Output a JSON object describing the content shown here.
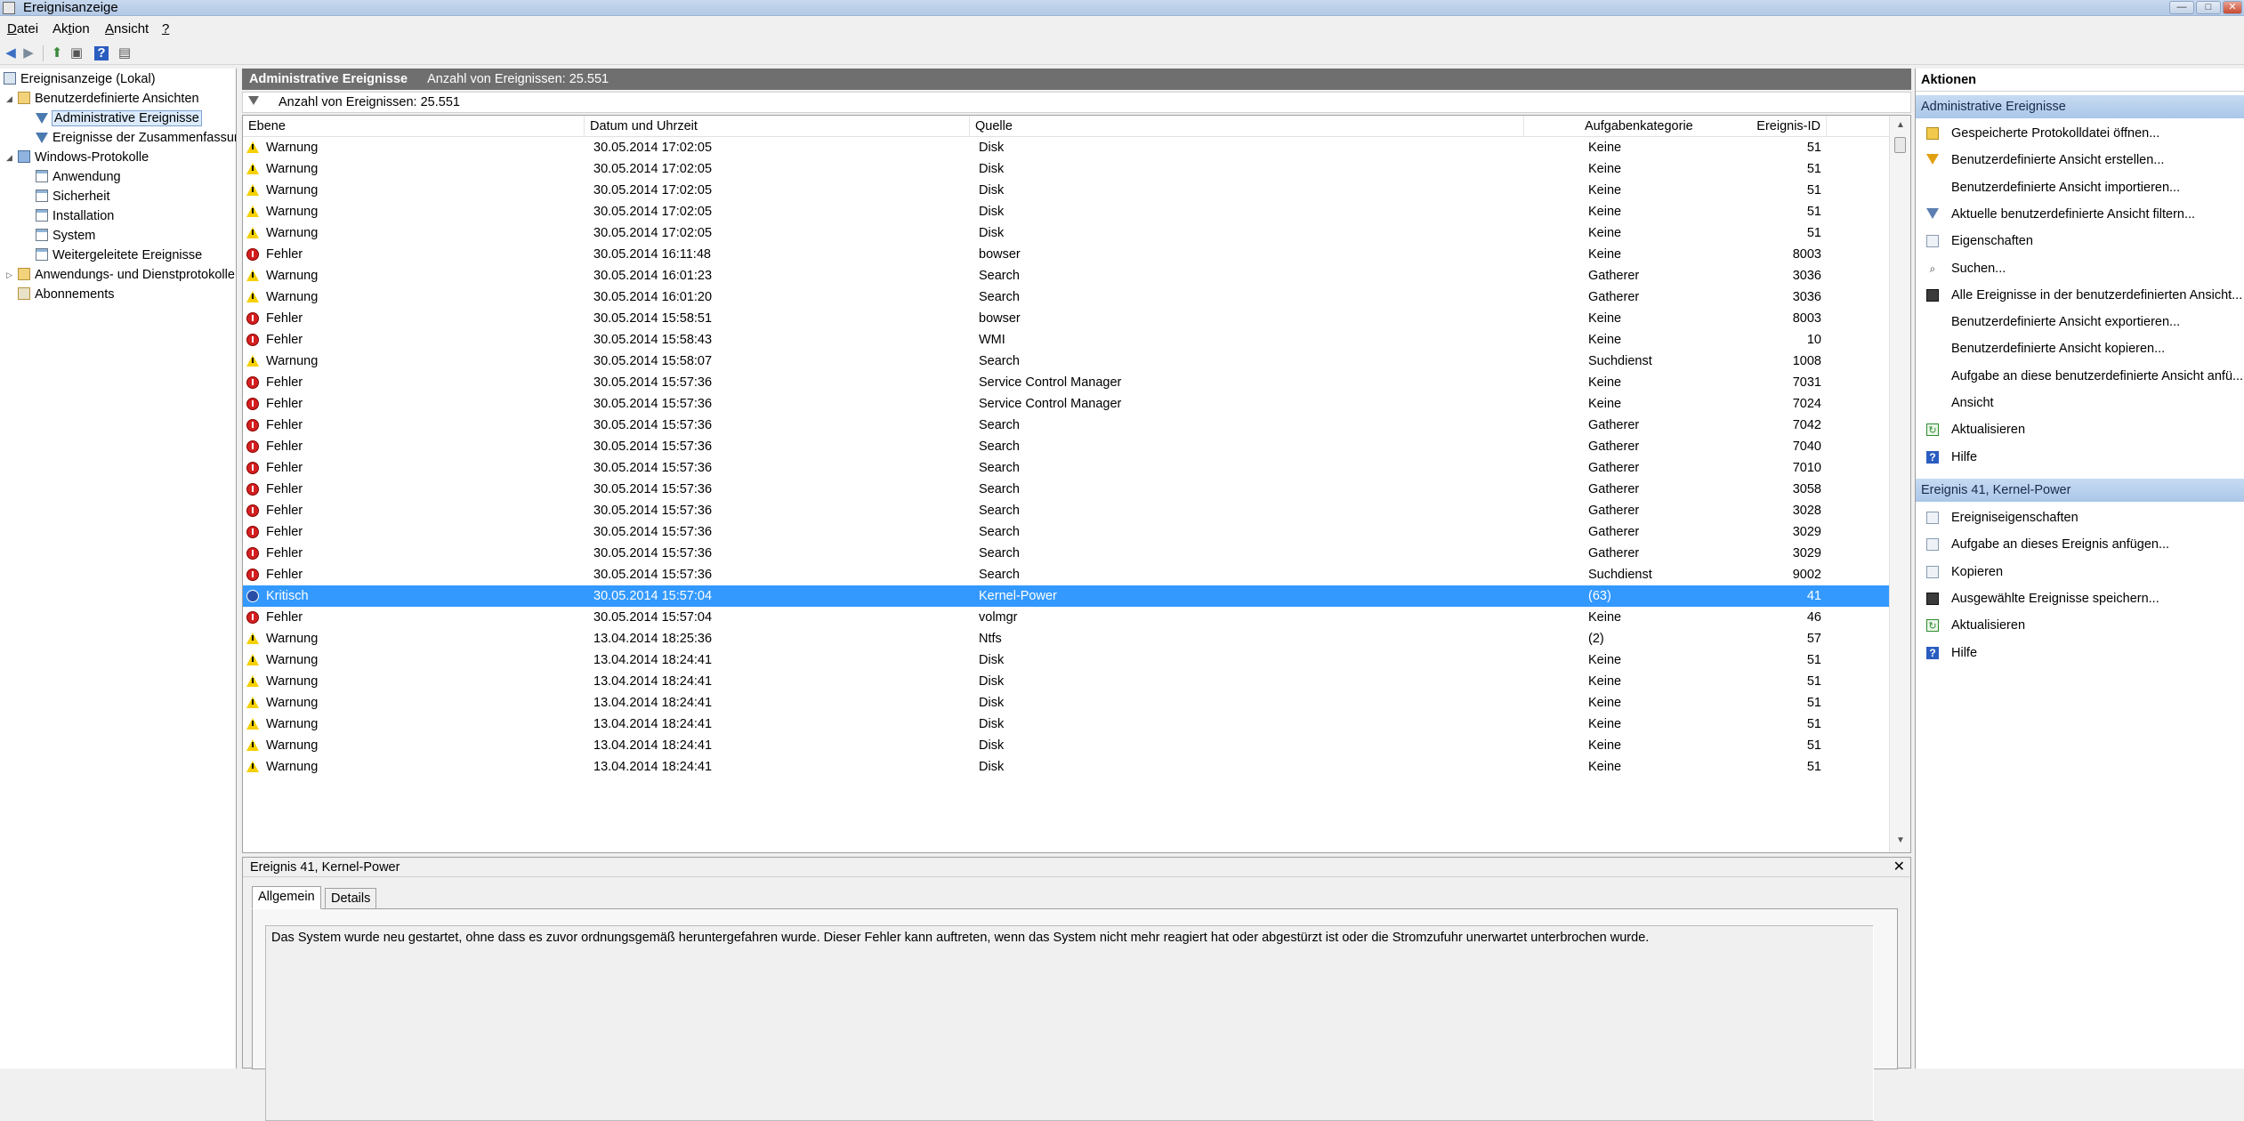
{
  "window": {
    "title": "Ereignisanzeige",
    "btn_min": "—",
    "btn_max": "□",
    "btn_close": "✕"
  },
  "menu": [
    {
      "pre": "",
      "u": "D",
      "post": "atei"
    },
    {
      "pre": "Ak",
      "u": "t",
      "post": "ion"
    },
    {
      "pre": "",
      "u": "A",
      "post": "nsicht"
    },
    {
      "pre": "",
      "u": "?",
      "post": ""
    }
  ],
  "toolbar": {
    "back": "◀",
    "forward": "▶",
    "up": "⬆",
    "show_hide": "▣",
    "help": "?",
    "properties": "▤"
  },
  "tree": {
    "root": "Ereignisanzeige (Lokal)",
    "custom_views": "Benutzerdefinierte Ansichten",
    "admin_events": "Administrative Ereignisse",
    "summary_events": "Ereignisse der Zusammenfassung",
    "windows_logs": "Windows-Protokolle",
    "application": "Anwendung",
    "security": "Sicherheit",
    "installation": "Installation",
    "system": "System",
    "forwarded": "Weitergeleitete Ereignisse",
    "app_services": "Anwendungs- und Dienstprotokolle",
    "subscriptions": "Abonnements"
  },
  "center": {
    "title": "Administrative Ereignisse",
    "count_text": "Anzahl von Ereignissen: 25.551",
    "filter_text": "Anzahl von Ereignissen: 25.551"
  },
  "columns": {
    "level": "Ebene",
    "datetime": "Datum und Uhrzeit",
    "source": "Quelle",
    "event_id": "Ereignis-ID",
    "category": "Aufgabenkategorie"
  },
  "events": [
    {
      "icon": "warning",
      "level": "Warnung",
      "datetime": "30.05.2014 17:02:05",
      "source": "Disk",
      "id": "51",
      "category": "Keine"
    },
    {
      "icon": "warning",
      "level": "Warnung",
      "datetime": "30.05.2014 17:02:05",
      "source": "Disk",
      "id": "51",
      "category": "Keine"
    },
    {
      "icon": "warning",
      "level": "Warnung",
      "datetime": "30.05.2014 17:02:05",
      "source": "Disk",
      "id": "51",
      "category": "Keine"
    },
    {
      "icon": "warning",
      "level": "Warnung",
      "datetime": "30.05.2014 17:02:05",
      "source": "Disk",
      "id": "51",
      "category": "Keine"
    },
    {
      "icon": "warning",
      "level": "Warnung",
      "datetime": "30.05.2014 17:02:05",
      "source": "Disk",
      "id": "51",
      "category": "Keine"
    },
    {
      "icon": "error",
      "level": "Fehler",
      "datetime": "30.05.2014 16:11:48",
      "source": "bowser",
      "id": "8003",
      "category": "Keine"
    },
    {
      "icon": "warning",
      "level": "Warnung",
      "datetime": "30.05.2014 16:01:23",
      "source": "Search",
      "id": "3036",
      "category": "Gatherer"
    },
    {
      "icon": "warning",
      "level": "Warnung",
      "datetime": "30.05.2014 16:01:20",
      "source": "Search",
      "id": "3036",
      "category": "Gatherer"
    },
    {
      "icon": "error",
      "level": "Fehler",
      "datetime": "30.05.2014 15:58:51",
      "source": "bowser",
      "id": "8003",
      "category": "Keine"
    },
    {
      "icon": "error",
      "level": "Fehler",
      "datetime": "30.05.2014 15:58:43",
      "source": "WMI",
      "id": "10",
      "category": "Keine"
    },
    {
      "icon": "warning",
      "level": "Warnung",
      "datetime": "30.05.2014 15:58:07",
      "source": "Search",
      "id": "1008",
      "category": "Suchdienst"
    },
    {
      "icon": "error",
      "level": "Fehler",
      "datetime": "30.05.2014 15:57:36",
      "source": "Service Control Manager",
      "id": "7031",
      "category": "Keine"
    },
    {
      "icon": "error",
      "level": "Fehler",
      "datetime": "30.05.2014 15:57:36",
      "source": "Service Control Manager",
      "id": "7024",
      "category": "Keine"
    },
    {
      "icon": "error",
      "level": "Fehler",
      "datetime": "30.05.2014 15:57:36",
      "source": "Search",
      "id": "7042",
      "category": "Gatherer"
    },
    {
      "icon": "error",
      "level": "Fehler",
      "datetime": "30.05.2014 15:57:36",
      "source": "Search",
      "id": "7040",
      "category": "Gatherer"
    },
    {
      "icon": "error",
      "level": "Fehler",
      "datetime": "30.05.2014 15:57:36",
      "source": "Search",
      "id": "7010",
      "category": "Gatherer"
    },
    {
      "icon": "error",
      "level": "Fehler",
      "datetime": "30.05.2014 15:57:36",
      "source": "Search",
      "id": "3058",
      "category": "Gatherer"
    },
    {
      "icon": "error",
      "level": "Fehler",
      "datetime": "30.05.2014 15:57:36",
      "source": "Search",
      "id": "3028",
      "category": "Gatherer"
    },
    {
      "icon": "error",
      "level": "Fehler",
      "datetime": "30.05.2014 15:57:36",
      "source": "Search",
      "id": "3029",
      "category": "Gatherer"
    },
    {
      "icon": "error",
      "level": "Fehler",
      "datetime": "30.05.2014 15:57:36",
      "source": "Search",
      "id": "3029",
      "category": "Gatherer"
    },
    {
      "icon": "error",
      "level": "Fehler",
      "datetime": "30.05.2014 15:57:36",
      "source": "Search",
      "id": "9002",
      "category": "Suchdienst"
    },
    {
      "icon": "critical",
      "level": "Kritisch",
      "datetime": "30.05.2014 15:57:04",
      "source": "Kernel-Power",
      "id": "41",
      "category": "(63)",
      "selected": true
    },
    {
      "icon": "error",
      "level": "Fehler",
      "datetime": "30.05.2014 15:57:04",
      "source": "volmgr",
      "id": "46",
      "category": "Keine"
    },
    {
      "icon": "warning",
      "level": "Warnung",
      "datetime": "13.04.2014 18:25:36",
      "source": "Ntfs",
      "id": "57",
      "category": "(2)"
    },
    {
      "icon": "warning",
      "level": "Warnung",
      "datetime": "13.04.2014 18:24:41",
      "source": "Disk",
      "id": "51",
      "category": "Keine"
    },
    {
      "icon": "warning",
      "level": "Warnung",
      "datetime": "13.04.2014 18:24:41",
      "source": "Disk",
      "id": "51",
      "category": "Keine"
    },
    {
      "icon": "warning",
      "level": "Warnung",
      "datetime": "13.04.2014 18:24:41",
      "source": "Disk",
      "id": "51",
      "category": "Keine"
    },
    {
      "icon": "warning",
      "level": "Warnung",
      "datetime": "13.04.2014 18:24:41",
      "source": "Disk",
      "id": "51",
      "category": "Keine"
    },
    {
      "icon": "warning",
      "level": "Warnung",
      "datetime": "13.04.2014 18:24:41",
      "source": "Disk",
      "id": "51",
      "category": "Keine"
    },
    {
      "icon": "warning",
      "level": "Warnung",
      "datetime": "13.04.2014 18:24:41",
      "source": "Disk",
      "id": "51",
      "category": "Keine"
    }
  ],
  "scrollbar": {
    "up": "▲",
    "down": "▼"
  },
  "detail": {
    "title": "Ereignis 41, Kernel-Power",
    "close": "✕",
    "tabs": [
      "Allgemein",
      "Details"
    ],
    "active_tab": "Allgemein",
    "text": "Das System wurde neu gestartet, ohne dass es zuvor ordnungsgemäß heruntergefahren wurde. Dieser Fehler kann auftreten, wenn das System nicht mehr reagiert hat oder abgestürzt ist oder die Stromzufuhr unerwartet unterbrochen wurde."
  },
  "actions": {
    "header": "Aktionen",
    "section1": "Administrative Ereignisse",
    "items1": [
      {
        "icon": "open-log-icon",
        "label": "Gespeicherte Protokolldatei öffnen..."
      },
      {
        "icon": "create-view-icon",
        "label": "Benutzerdefinierte Ansicht erstellen..."
      },
      {
        "icon": "",
        "label": "Benutzerdefinierte Ansicht importieren..."
      },
      {
        "icon": "filter-icon",
        "label": "Aktuelle benutzerdefinierte Ansicht filtern..."
      },
      {
        "icon": "properties-icon",
        "label": "Eigenschaften"
      },
      {
        "icon": "find-icon",
        "label": "Suchen..."
      },
      {
        "icon": "save-icon",
        "label": "Alle Ereignisse in der benutzerdefinierten Ansicht..."
      },
      {
        "icon": "",
        "label": "Benutzerdefinierte Ansicht exportieren..."
      },
      {
        "icon": "",
        "label": "Benutzerdefinierte Ansicht kopieren..."
      },
      {
        "icon": "",
        "label": "Aufgabe an diese benutzerdefinierte Ansicht anfü..."
      },
      {
        "icon": "",
        "label": "Ansicht"
      },
      {
        "icon": "refresh-icon",
        "label": "Aktualisieren"
      },
      {
        "icon": "help-icon",
        "label": "Hilfe"
      }
    ],
    "section2": "Ereignis 41, Kernel-Power",
    "items2": [
      {
        "icon": "event-properties-icon",
        "label": "Ereigniseigenschaften"
      },
      {
        "icon": "attach-task-icon",
        "label": "Aufgabe an dieses Ereignis anfügen..."
      },
      {
        "icon": "copy-icon",
        "label": "Kopieren"
      },
      {
        "icon": "save-icon",
        "label": "Ausgewählte Ereignisse speichern..."
      },
      {
        "icon": "refresh-icon",
        "label": "Aktualisieren"
      },
      {
        "icon": "help-icon",
        "label": "Hilfe"
      }
    ]
  }
}
